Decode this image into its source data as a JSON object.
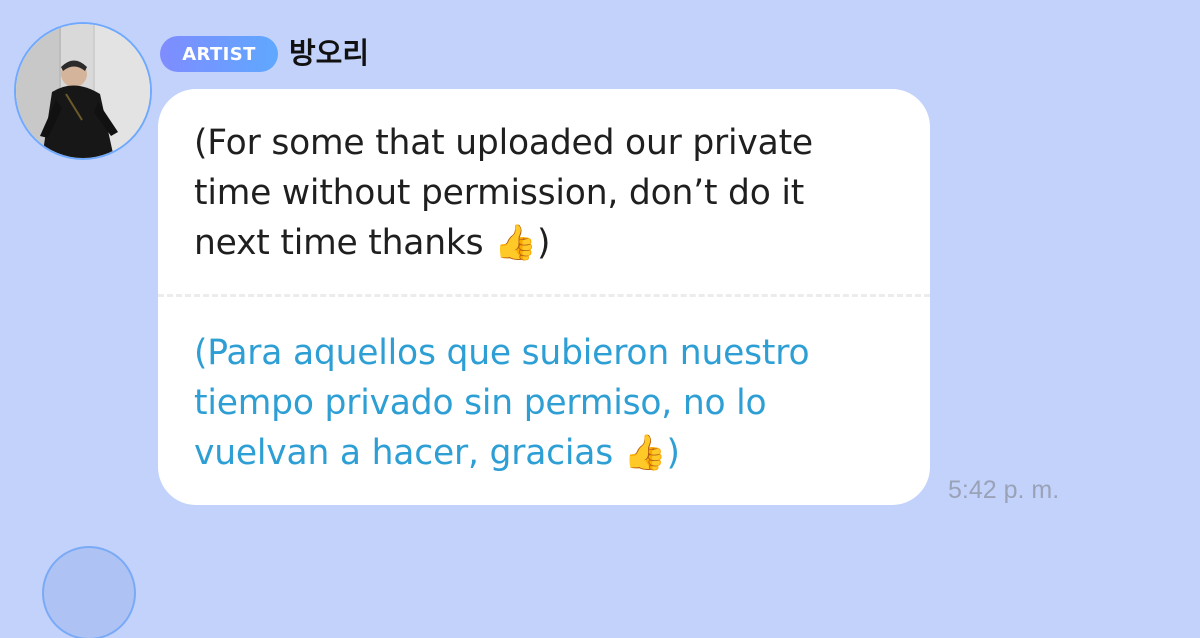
{
  "chat": {
    "sender": {
      "badge": "ARTIST",
      "name": "방오리"
    },
    "message": {
      "original": "(For some that uploaded our private\ntime without permission, don’t do it\nnext time thanks 👍)",
      "translated": "(Para aquellos que subieron nuestro\ntiempo privado sin permiso, no lo\nvuelvan a hacer, gracias 👍)",
      "time": "5:42 p. m."
    },
    "colors": {
      "background": "#c3d2fb",
      "bubble": "#ffffff",
      "translation_text": "#2e9fd4",
      "badge_gradient_start": "#7f8cff",
      "badge_gradient_end": "#5fa8ff",
      "timestamp": "#9aa2b8"
    },
    "icons": {
      "reaction_emoji": "thumbs-up-icon"
    }
  }
}
